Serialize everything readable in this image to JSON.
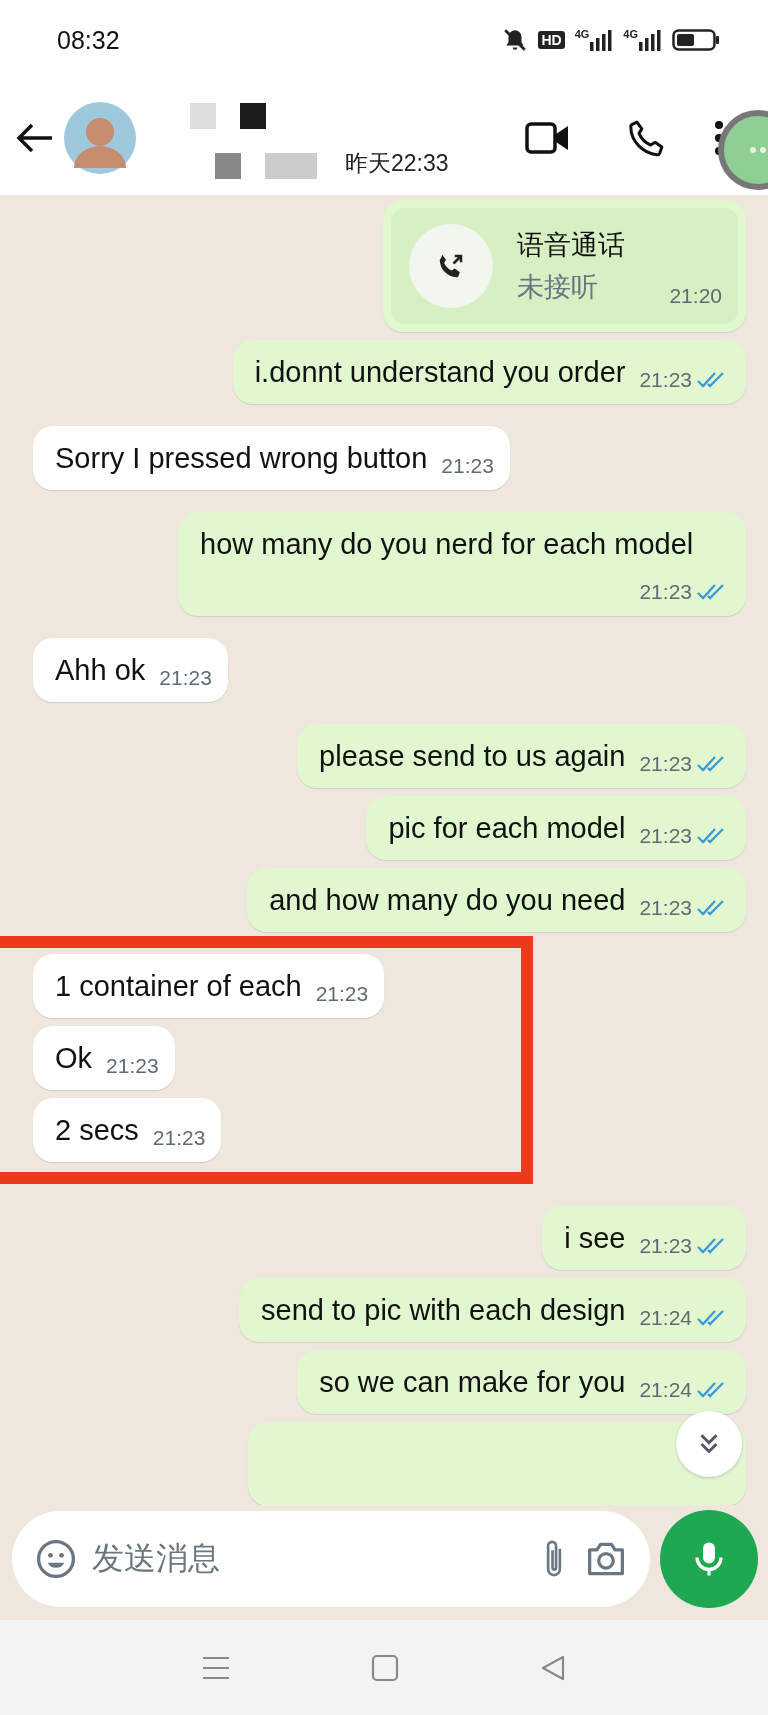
{
  "status_bar": {
    "time": "08:32",
    "hd": "HD",
    "networks": [
      "4G",
      "4G"
    ]
  },
  "header": {
    "last_seen": "昨天22:33"
  },
  "messages": [
    {
      "kind": "call",
      "outgoing": true,
      "title": "语音通话",
      "subtitle": "未接听",
      "time": "21:20"
    },
    {
      "kind": "text",
      "outgoing": true,
      "text": "i.donnt understand you order",
      "time": "21:23",
      "read": true
    },
    {
      "kind": "text",
      "outgoing": false,
      "text": "Sorry I pressed wrong button",
      "time": "21:23"
    },
    {
      "kind": "text",
      "outgoing": true,
      "text": "how many do you nerd for each model",
      "time": "21:23",
      "read": true
    },
    {
      "kind": "text",
      "outgoing": false,
      "text": "Ahh ok",
      "time": "21:23"
    },
    {
      "kind": "text",
      "outgoing": true,
      "text": "please send to us again",
      "time": "21:23",
      "read": true
    },
    {
      "kind": "text",
      "outgoing": true,
      "text": "pic for each model",
      "time": "21:23",
      "read": true
    },
    {
      "kind": "text",
      "outgoing": true,
      "text": "and how many do you need",
      "time": "21:23",
      "read": true
    },
    {
      "kind": "text",
      "outgoing": false,
      "text": "1 container of each",
      "time": "21:23",
      "highlighted": true
    },
    {
      "kind": "text",
      "outgoing": false,
      "text": "Ok",
      "time": "21:23",
      "highlighted": true
    },
    {
      "kind": "text",
      "outgoing": false,
      "text": "2 secs",
      "time": "21:23",
      "highlighted": true
    },
    {
      "kind": "text",
      "outgoing": true,
      "text": "i see",
      "time": "21:23",
      "read": true
    },
    {
      "kind": "text",
      "outgoing": true,
      "text": "send to pic with each design",
      "time": "21:24",
      "read": true
    },
    {
      "kind": "text",
      "outgoing": true,
      "text": "so we can make for you",
      "time": "21:24",
      "read": true
    },
    {
      "kind": "partial",
      "outgoing": true
    }
  ],
  "composer": {
    "placeholder": "发送消息"
  }
}
